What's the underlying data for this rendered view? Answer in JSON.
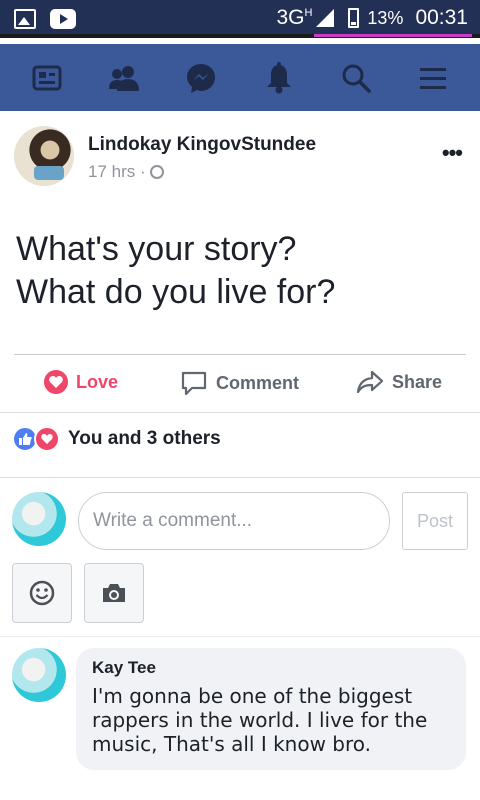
{
  "status_bar": {
    "network": "3G",
    "network_sup": "H",
    "battery_pct": "13%",
    "time": "00:31"
  },
  "nav": {
    "items": [
      "news-feed-icon",
      "friends-icon",
      "messenger-icon",
      "notifications-icon",
      "search-icon",
      "menu-icon"
    ]
  },
  "post": {
    "author": "Lindokay KingovStundee",
    "time": "17 hrs ·",
    "text_line1": "What's your story?",
    "text_line2": "What do you live for?",
    "more": "•••"
  },
  "actions": {
    "love": "Love",
    "comment": "Comment",
    "share": "Share"
  },
  "reactions": {
    "summary": "You and 3 others"
  },
  "composer": {
    "placeholder": "Write a comment...",
    "post_label": "Post"
  },
  "comments": [
    {
      "author": "Kay Tee",
      "text": "I'm gonna be one of the biggest rappers in the world. I live for the music, That's all I know bro."
    }
  ],
  "colors": {
    "status_bar": "#233055",
    "nav_bar": "#3b5998",
    "love": "#f0466a",
    "like": "#4f7ef2"
  }
}
